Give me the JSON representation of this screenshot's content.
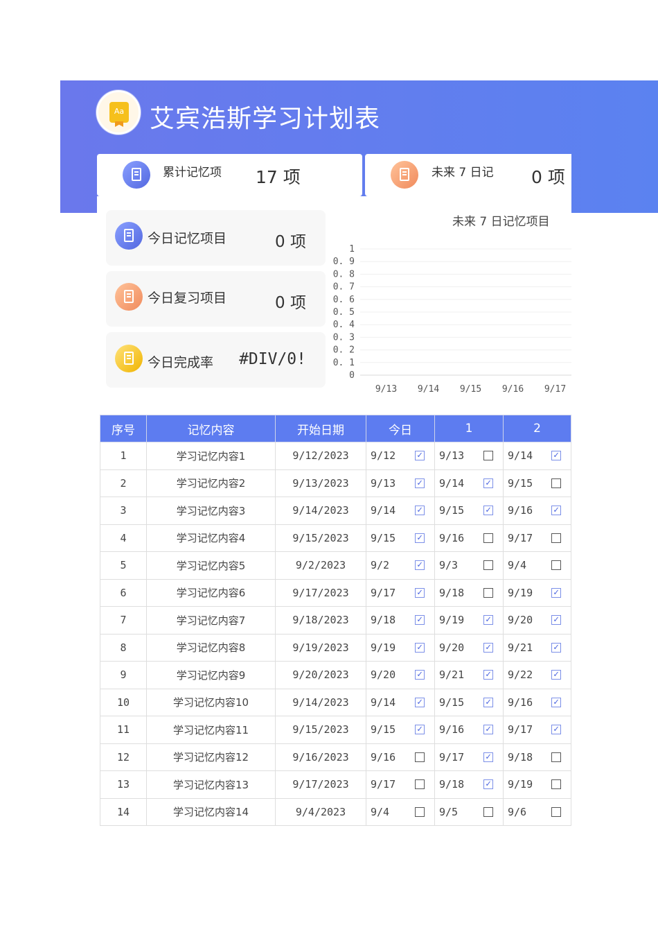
{
  "header": {
    "title": "艾宾浩斯学习计划表",
    "logo_text": "Aa"
  },
  "stats": {
    "total_label": "累计记忆项",
    "total_value": "17 项",
    "diary_label": "未来 7 日记",
    "diary_value": "0 项"
  },
  "kpis": [
    {
      "label": "今日记忆项目",
      "value": "0 项",
      "color": "blue"
    },
    {
      "label": "今日复习项目",
      "value": "0 项",
      "color": "orange"
    },
    {
      "label": "今日完成率",
      "value": "#DIV/0!",
      "color": "yellow"
    }
  ],
  "chart_data": {
    "type": "bar",
    "title": "未来 7 日记忆项目",
    "categories": [
      "9/13",
      "9/14",
      "9/15",
      "9/16",
      "9/17"
    ],
    "values": [
      0,
      0,
      0,
      0,
      0
    ],
    "y_ticks": [
      "1",
      "0. 9",
      "0. 8",
      "0. 7",
      "0. 6",
      "0. 5",
      "0. 4",
      "0. 3",
      "0. 2",
      "0. 1",
      "0"
    ],
    "ylim": [
      0,
      1
    ],
    "grid": true
  },
  "table": {
    "headers": [
      "序号",
      "记忆内容",
      "开始日期",
      "今日",
      "1",
      "2"
    ],
    "rows": [
      {
        "no": "1",
        "content": "学习记忆内容1",
        "start": "9/12/2023",
        "d0": "9/12",
        "c0": true,
        "d1": "9/13",
        "c1": false,
        "d2": "9/14",
        "c2": true
      },
      {
        "no": "2",
        "content": "学习记忆内容2",
        "start": "9/13/2023",
        "d0": "9/13",
        "c0": true,
        "d1": "9/14",
        "c1": true,
        "d2": "9/15",
        "c2": false
      },
      {
        "no": "3",
        "content": "学习记忆内容3",
        "start": "9/14/2023",
        "d0": "9/14",
        "c0": true,
        "d1": "9/15",
        "c1": true,
        "d2": "9/16",
        "c2": true
      },
      {
        "no": "4",
        "content": "学习记忆内容4",
        "start": "9/15/2023",
        "d0": "9/15",
        "c0": true,
        "d1": "9/16",
        "c1": false,
        "d2": "9/17",
        "c2": false
      },
      {
        "no": "5",
        "content": "学习记忆内容5",
        "start": "9/2/2023",
        "d0": "9/2",
        "c0": true,
        "d1": "9/3",
        "c1": false,
        "d2": "9/4",
        "c2": false
      },
      {
        "no": "6",
        "content": "学习记忆内容6",
        "start": "9/17/2023",
        "d0": "9/17",
        "c0": true,
        "d1": "9/18",
        "c1": false,
        "d2": "9/19",
        "c2": true
      },
      {
        "no": "7",
        "content": "学习记忆内容7",
        "start": "9/18/2023",
        "d0": "9/18",
        "c0": true,
        "d1": "9/19",
        "c1": true,
        "d2": "9/20",
        "c2": true
      },
      {
        "no": "8",
        "content": "学习记忆内容8",
        "start": "9/19/2023",
        "d0": "9/19",
        "c0": true,
        "d1": "9/20",
        "c1": true,
        "d2": "9/21",
        "c2": true
      },
      {
        "no": "9",
        "content": "学习记忆内容9",
        "start": "9/20/2023",
        "d0": "9/20",
        "c0": true,
        "d1": "9/21",
        "c1": true,
        "d2": "9/22",
        "c2": true
      },
      {
        "no": "10",
        "content": "学习记忆内容10",
        "start": "9/14/2023",
        "d0": "9/14",
        "c0": true,
        "d1": "9/15",
        "c1": true,
        "d2": "9/16",
        "c2": true
      },
      {
        "no": "11",
        "content": "学习记忆内容11",
        "start": "9/15/2023",
        "d0": "9/15",
        "c0": true,
        "d1": "9/16",
        "c1": true,
        "d2": "9/17",
        "c2": true
      },
      {
        "no": "12",
        "content": "学习记忆内容12",
        "start": "9/16/2023",
        "d0": "9/16",
        "c0": false,
        "d1": "9/17",
        "c1": true,
        "d2": "9/18",
        "c2": false
      },
      {
        "no": "13",
        "content": "学习记忆内容13",
        "start": "9/17/2023",
        "d0": "9/17",
        "c0": false,
        "d1": "9/18",
        "c1": true,
        "d2": "9/19",
        "c2": false
      },
      {
        "no": "14",
        "content": "学习记忆内容14",
        "start": "9/4/2023",
        "d0": "9/4",
        "c0": false,
        "d1": "9/5",
        "c1": false,
        "d2": "9/6",
        "c2": false
      }
    ]
  },
  "check_glyph": "☑",
  "colors": {
    "banner": "#6a78ec",
    "header_row": "#5d7cf0",
    "checked": "#4a64e0"
  }
}
